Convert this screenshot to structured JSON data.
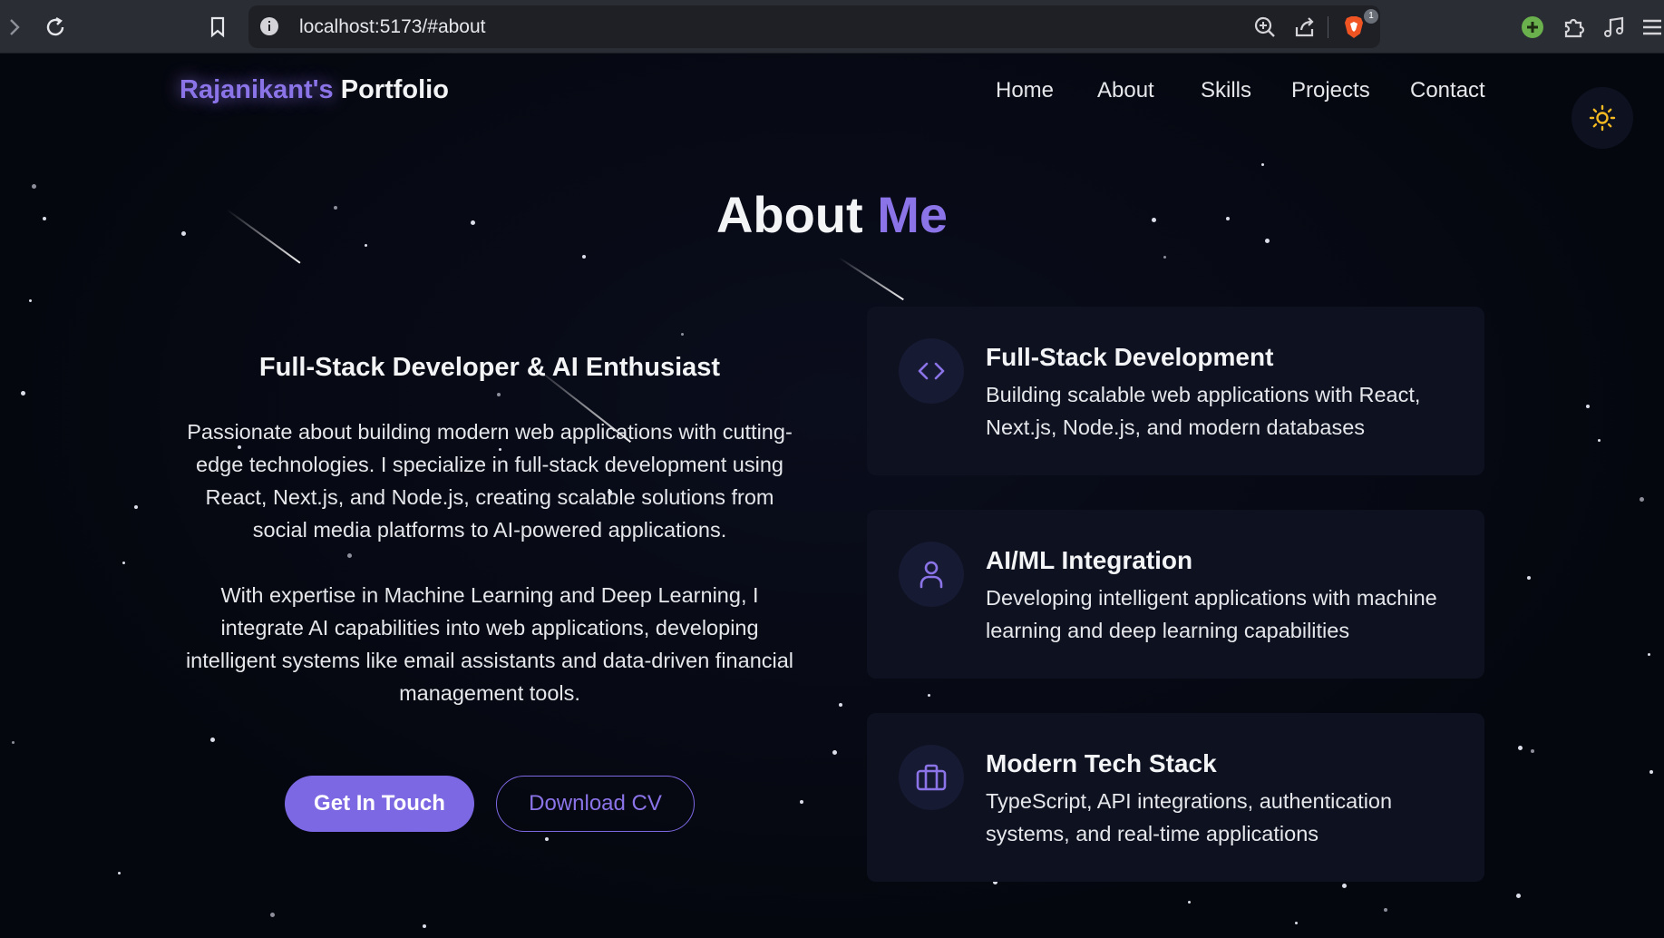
{
  "browser": {
    "url": "localhost:5173/#about",
    "extension_badge": "1",
    "icons": [
      "forward-icon",
      "reload-icon",
      "bookmark-icon",
      "site-info-icon",
      "zoom-icon",
      "share-icon",
      "brave-shields-icon",
      "extension-green-icon",
      "extensions-icon",
      "media-icon",
      "menu-icon"
    ]
  },
  "header": {
    "logo_accent": "Rajanikant's",
    "logo_rest": "Portfolio",
    "nav": [
      "Home",
      "About",
      "Skills",
      "Projects",
      "Contact"
    ],
    "theme_toggle_icon": "sun-icon"
  },
  "about": {
    "title_white": "About",
    "title_purple": "Me",
    "subtitle": "Full-Stack Developer & AI Enthusiast",
    "paragraph_1": "Passionate about building modern web applications with cutting-edge technologies. I specialize in full-stack development using React, Next.js, and Node.js, creating scalable solutions from social media platforms to AI-powered applications.",
    "paragraph_2": "With expertise in Machine Learning and Deep Learning, I integrate AI capabilities into web applications, developing intelligent systems like email assistants and data-driven financial management tools.",
    "primary_button": "Get In Touch",
    "secondary_button": "Download CV"
  },
  "cards": [
    {
      "icon": "code-icon",
      "title": "Full-Stack Development",
      "description": "Building scalable web applications with React, Next.js, Node.js, and modern databases"
    },
    {
      "icon": "user-icon",
      "title": "AI/ML Integration",
      "description": "Developing intelligent applications with machine learning and deep learning capabilities"
    },
    {
      "icon": "briefcase-icon",
      "title": "Modern Tech Stack",
      "description": "TypeScript, API integrations, authentication systems, and real-time applications"
    }
  ],
  "colors": {
    "accent": "#8b73e8",
    "button": "#7c68e3",
    "background": "#05070f",
    "card": "#0e1120",
    "sun": "#f5b921"
  }
}
